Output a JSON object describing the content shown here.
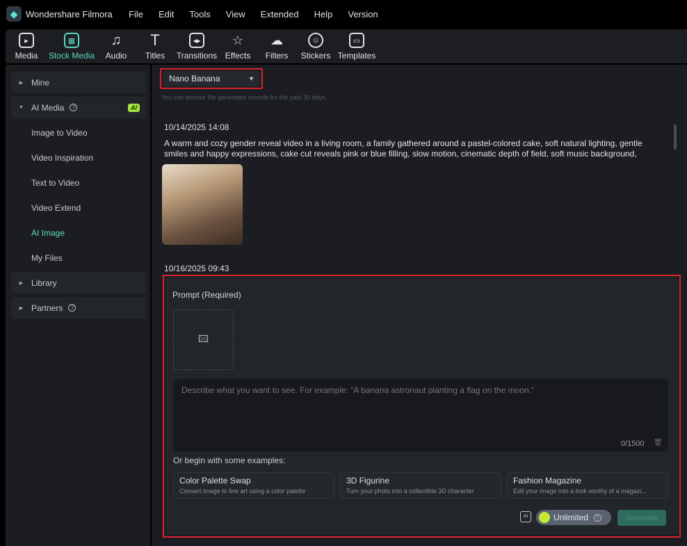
{
  "app": {
    "title": "Wondershare Filmora",
    "menu": [
      "File",
      "Edit",
      "Tools",
      "View",
      "Extended",
      "Help",
      "Version"
    ]
  },
  "toolbar": [
    {
      "label": "Media",
      "icon": "media-icon"
    },
    {
      "label": "Stock Media",
      "icon": "stock-media-icon",
      "active": true
    },
    {
      "label": "Audio",
      "icon": "music-note-icon"
    },
    {
      "label": "Titles",
      "icon": "text-icon"
    },
    {
      "label": "Transitions",
      "icon": "transition-icon"
    },
    {
      "label": "Effects",
      "icon": "effects-star-icon"
    },
    {
      "label": "Filters",
      "icon": "filters-icon"
    },
    {
      "label": "Stickers",
      "icon": "sticker-icon"
    },
    {
      "label": "Templates",
      "icon": "templates-icon"
    }
  ],
  "sidebar": {
    "mine": "Mine",
    "ai_media": "AI Media",
    "ai_badge": "AI",
    "subitems": [
      "Image to Video",
      "Video Inspiration",
      "Text to Video",
      "Video Extend",
      "AI Image",
      "My Files"
    ],
    "active": "AI Image",
    "library": "Library",
    "partners": "Partners"
  },
  "main": {
    "model_select": "Nano Banana",
    "note": "You can browse the generated records for the past 30 days.",
    "record": {
      "date": "10/14/2025 14:08",
      "prompt": "A warm and cozy gender reveal video in a living room, a family gathered around a pastel-colored cake, soft natural lighting, gentle smiles and happy expressions, cake cut reveals pink or blue filling, slow motion, cinematic depth of field, soft music background, heartwarmi..."
    },
    "date2": "10/16/2025 09:43",
    "prompt_label": "Prompt (Required)",
    "prompt_placeholder": "Describe what you want to see. For example: “A banana astronaut planting a flag on the moon.”",
    "char_count": "0/1500",
    "examples_label": "Or begin with some examples:",
    "examples": [
      {
        "title": "Color Palette Swap",
        "desc": "Convert image to line art using a color palette"
      },
      {
        "title": "3D Figurine",
        "desc": "Turn your photo into a collectible 3D character"
      },
      {
        "title": "Fashion Magazine",
        "desc": "Edit your image into a look worthy of a magazi..."
      }
    ],
    "unlimited": "Unlimited",
    "generate": "Generate"
  },
  "colors": {
    "accent": "#5fd8c0",
    "highlight_border": "#d9232e",
    "ai_badge": "#a6e63a"
  }
}
